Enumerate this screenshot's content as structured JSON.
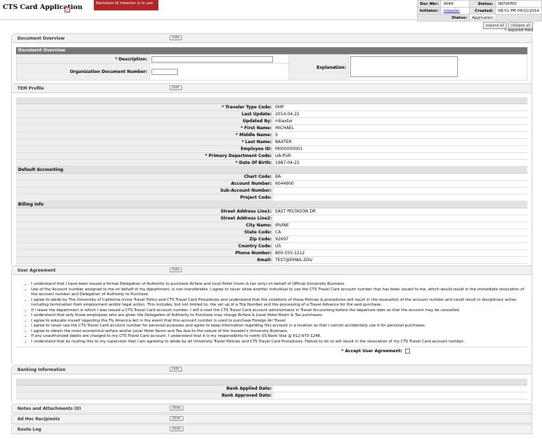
{
  "header": {
    "title": "CTS Card Application",
    "help_icon": "help-icon",
    "backdoor_text": "Backdoor Id mbaxter is in use",
    "doc_nbr_label": "Doc Nbr:",
    "doc_nbr": "6084",
    "status_label": "Status:",
    "status": "INITIATED",
    "initiator_label": "Initiator:",
    "initiator": "mbaxter",
    "created_label": "Created:",
    "created": "08:51 PM 04/22/2014",
    "doc_status_label": "Status:",
    "doc_status": "Application"
  },
  "controls": {
    "expand_all": "expand all",
    "collapse_all": "collapse all",
    "required_note": "* required field"
  },
  "tabs": {
    "document_overview": "Document Overview",
    "tem_profile": "TEM Profile",
    "user_agreement": "User Agreement",
    "banking_information": "Banking Information",
    "notes_attachments": "Notes and Attachments (0)",
    "ad_hoc_recipients": "Ad Hoc Recipients",
    "route_log": "Route Log",
    "hide": "hide",
    "show": "show"
  },
  "document_overview": {
    "section_title": "Document Overview",
    "description_label": "* Description:",
    "description_value": "",
    "org_doc_number_label": "Organization Document Number:",
    "org_doc_number_value": "",
    "explanation_label": "Explanation:",
    "explanation_value": ""
  },
  "tem_profile": {
    "fields": [
      {
        "label": "* Traveler Type Code:",
        "value": "EMP"
      },
      {
        "label": "Last Update:",
        "value": "2014-04-22"
      },
      {
        "label": "Updated By:",
        "value": "mbaxter"
      },
      {
        "label": "* First Name:",
        "value": "MICHAEL"
      },
      {
        "label": "* Middle Name:",
        "value": "S"
      },
      {
        "label": "* Last Name:",
        "value": "BAXTER"
      },
      {
        "label": "Employee ID:",
        "value": "M000000001"
      },
      {
        "label": "* Primary Department Code:",
        "value": "UA-PUR"
      },
      {
        "label": "* Date Of Birth:",
        "value": "1987-04-22"
      }
    ],
    "default_accounting_title": "Default Accounting",
    "default_accounting": [
      {
        "label": "Chart Code:",
        "value": "BA"
      },
      {
        "label": "Account Number:",
        "value": "6044900"
      },
      {
        "label": "Sub-Account Number:",
        "value": ""
      },
      {
        "label": "Project Code:",
        "value": ""
      }
    ],
    "billing_info_title": "Billing Info",
    "billing_info": [
      {
        "label": "Street Address Line1:",
        "value": "EAST PELTASON DR"
      },
      {
        "label": "Street Address Line2:",
        "value": ""
      },
      {
        "label": "City Name:",
        "value": "IRVINE"
      },
      {
        "label": "State Code:",
        "value": "CA"
      },
      {
        "label": "Zip Code:",
        "value": "92697"
      },
      {
        "label": "Country Code:",
        "value": "US"
      },
      {
        "label": "Phone Number:",
        "value": "800-555-1212"
      },
      {
        "label": "Email:",
        "value": "TEST@EMAIL.EDU"
      }
    ]
  },
  "user_agreement": {
    "items": [
      "I understand that I have been issued a formal Delegation of Authority to purchase Airfare and local Hotel (room & tax only) on behalf of Official University Business.",
      "Use of the Account number assigned to me on behalf of my department, is non-transferable. I agree to never allow another individual to use the CTS Travel Card account number that has been issued to me, which would result in the immediate revocation of the account number and Delegation of Authority to Purchase.",
      "I agree to abide by The University of California Irvine Travel Policy and CTS Travel Card Procedures and understand that the violations of these Policies & procedures will result in the revocation of the account number and could result in disciplinary action including termination from employment and/or legal action. This includes, but not limited to, the set up of a Trip Number and the processing of a Travel Advance for the said purchase.",
      "If I leave the department in which I was issued a CTS Travel Card account number, I will e-mail the CTS Travel Card account administrator in Travel Accounting before the departure date so that the account may be cancelled.",
      "I understand that only those employees who are given the Delegation of Authority to Purchase may charge Airfare & Local Hotel Room & Tax purchases.",
      "I agree to educate myself regarding the Fly America Act in the event that this account number is used to purchase Foreign Air Travel.",
      "I agree to never use the CTS Travel Card account number for personal purposes and agree to keep information regarding this account in a location so that I cannot accidentally use it for personal purchases.",
      "I agree to obtain the most economical airfare and/or Local Hotel Room and Tax due to the nature of the traveler's University Business.",
      "If any unauthorized debits are charged to my CTS Travel Card account, I understand that it is my responsibility to notify US Bank Visa @ 612-973-1248.",
      "I understand that by routing this to my supervisor that I am agreeing to abide by all University Travel Policies and CTS Travel Card Procedures. Failure to do so will result in the revocation of my CTS Travel Card account number."
    ],
    "accept_label": "* Accept User Agreement:"
  },
  "banking_information": {
    "fields": [
      {
        "label": "Bank Applied Date:",
        "value": ""
      },
      {
        "label": "Bank Approved Date:",
        "value": ""
      }
    ]
  }
}
